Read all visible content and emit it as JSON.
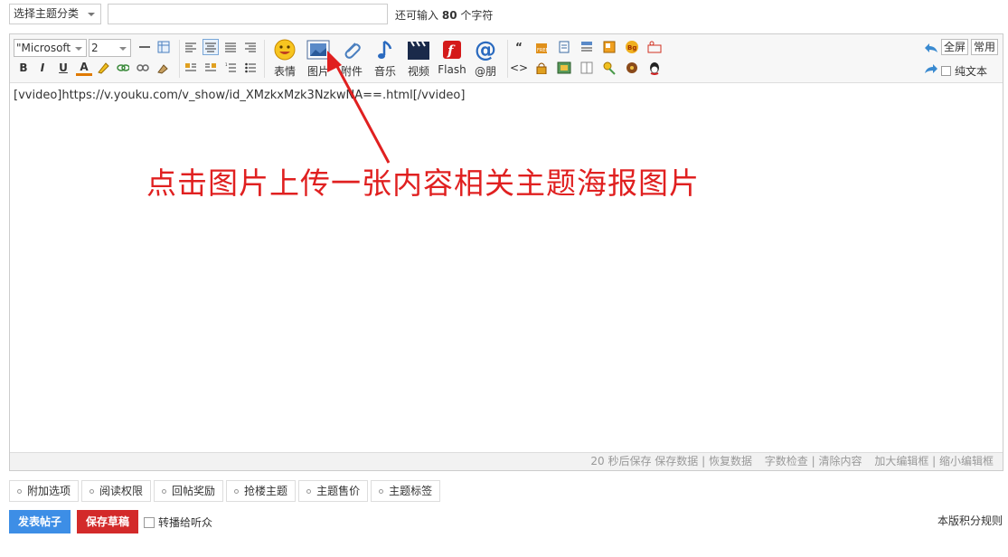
{
  "topic": {
    "label": "选择主题分类"
  },
  "title_input": {
    "value": ""
  },
  "char_hint": {
    "prefix": "还可输入",
    "count": "80",
    "suffix": "个字符"
  },
  "toolbar": {
    "font": "\"Microsoft",
    "size": "2",
    "format_buttons": [
      "B",
      "I",
      "U",
      "A"
    ],
    "big_buttons": [
      "表情",
      "图片",
      "附件",
      "音乐",
      "视频",
      "Flash",
      "@朋"
    ],
    "fullscreen": "全屏",
    "common": "常用",
    "plain_text": "纯文本"
  },
  "content": "[vvideo]https://v.youku.com/v_show/id_XMzkxMzk3NzkwNA==.html[/vvideo]",
  "annotation": "点击图片上传一张内容相关主题海报图片",
  "status_bar": [
    "20 秒后保存 保存数据 | 恢复数据",
    "字数检查 | 清除内容",
    "加大编辑框 | 缩小编辑框"
  ],
  "options": [
    "附加选项",
    "阅读权限",
    "回帖奖励",
    "抢楼主题",
    "主题售价",
    "主题标签"
  ],
  "actions": {
    "post": "发表帖子",
    "draft": "保存草稿",
    "repost": "转播给听众",
    "rules": "本版积分规则"
  },
  "colors": {
    "accent_blue": "#3d8ee6",
    "accent_red": "#d32a2a",
    "annotation_red": "#e02020"
  }
}
